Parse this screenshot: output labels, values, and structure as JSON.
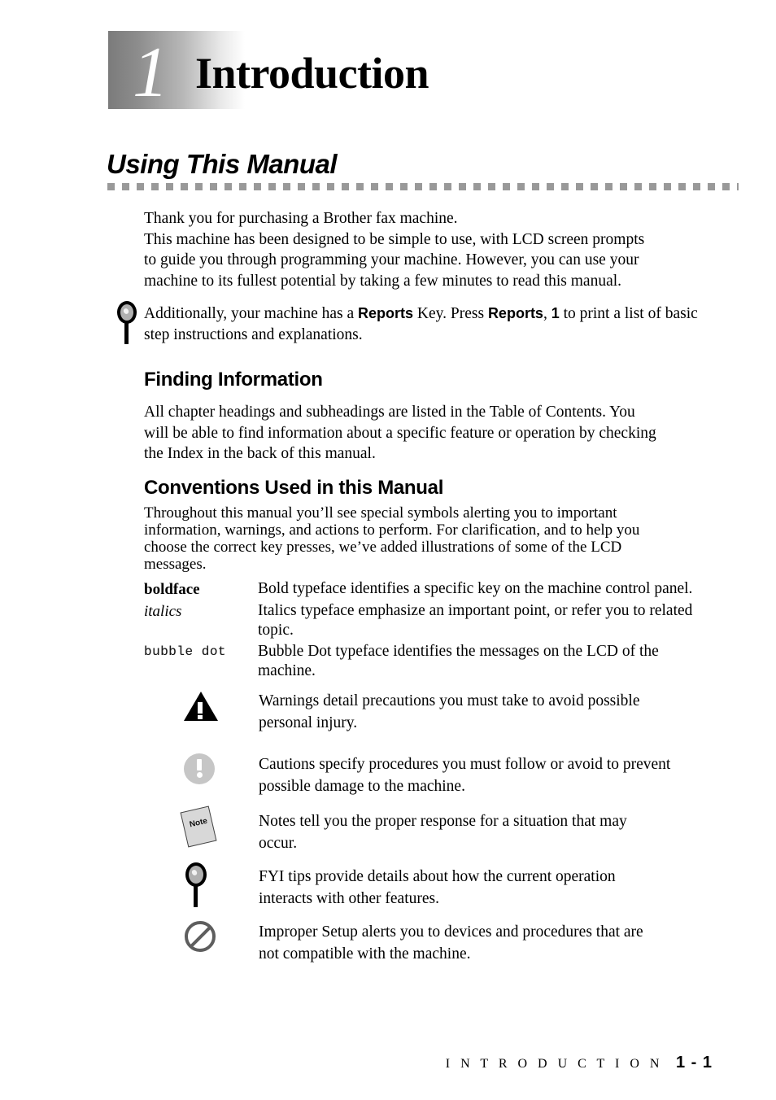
{
  "chapter": {
    "number": "1",
    "title": "Introduction"
  },
  "section": {
    "heading": "Using This Manual"
  },
  "intro_paragraph": {
    "lines": [
      "Thank you for purchasing a Brother fax machine.",
      "This machine has been designed to be simple to use, with LCD screen prompts",
      "to guide you through programming your machine. However, you can use your",
      "machine to its fullest potential by taking a few minutes to read this manual."
    ]
  },
  "fyi_callout": {
    "icon": "magnifier-icon",
    "text_part1": "Additionally, your machine has a ",
    "key1": "Reports",
    "text_part2": " Key. Press ",
    "key2": "Reports",
    "text_part3": ", ",
    "key3": "1",
    "text_part4": " to print a list of basic step instructions and explanations."
  },
  "finding_information": {
    "heading": "Finding Information",
    "lines": [
      "All chapter headings and subheadings are listed in the Table of Contents. You",
      "will be able to find information about a specific feature or operation by checking",
      "the Index in the back of this manual."
    ]
  },
  "conventions": {
    "heading": "Conventions Used in this Manual",
    "lines": [
      "Throughout this manual you’ll see special symbols alerting you to important",
      "information, warnings, and actions to perform. For clarification, and to help you",
      "choose the correct key presses, we’ve added illustrations of some of the LCD",
      "messages."
    ],
    "typefaces": [
      {
        "term": "boldface",
        "style": "bold",
        "description_lines": [
          "Bold typeface identifies a specific key on the machine control panel."
        ]
      },
      {
        "term": "italics",
        "style": "italic",
        "description_lines": [
          "Italics typeface emphasize an important point, or refer you to related",
          "topic."
        ]
      },
      {
        "term": "bubble dot",
        "style": "bubble-dot",
        "description_lines": [
          "Bubble Dot typeface identifies the messages on the LCD of the",
          "machine."
        ]
      }
    ],
    "symbols": [
      {
        "icon": "warning-triangle-icon",
        "description_lines": [
          "Warnings detail precautions you must take to avoid possible",
          "personal injury."
        ]
      },
      {
        "icon": "caution-exclamation-icon",
        "description_lines": [
          "Cautions specify procedures you must follow or avoid to prevent",
          "possible damage to the machine."
        ]
      },
      {
        "icon": "note-page-icon",
        "icon_label": "Note",
        "description_lines": [
          "Notes tell you the proper response for a situation that may",
          "occur."
        ]
      },
      {
        "icon": "magnifier-icon",
        "description_lines": [
          "FYI tips provide details about how the current operation",
          "interacts with other features."
        ]
      },
      {
        "icon": "prohibition-icon",
        "description_lines": [
          "Improper Setup alerts you to devices and procedures that are",
          "not compatible with the machine."
        ]
      }
    ]
  },
  "footer": {
    "chapter_name": "I N T R O D U C T I O N",
    "page_number": "1 - 1"
  },
  "colors": {
    "rule_gray": "#999999",
    "badge_gradient_start": "#7b7b7b",
    "badge_gradient_end": "#ffffff",
    "caution_gray": "#c6c6c6",
    "prohibit_gray": "#5e5e5e",
    "note_gray": "#d8d8d8"
  }
}
